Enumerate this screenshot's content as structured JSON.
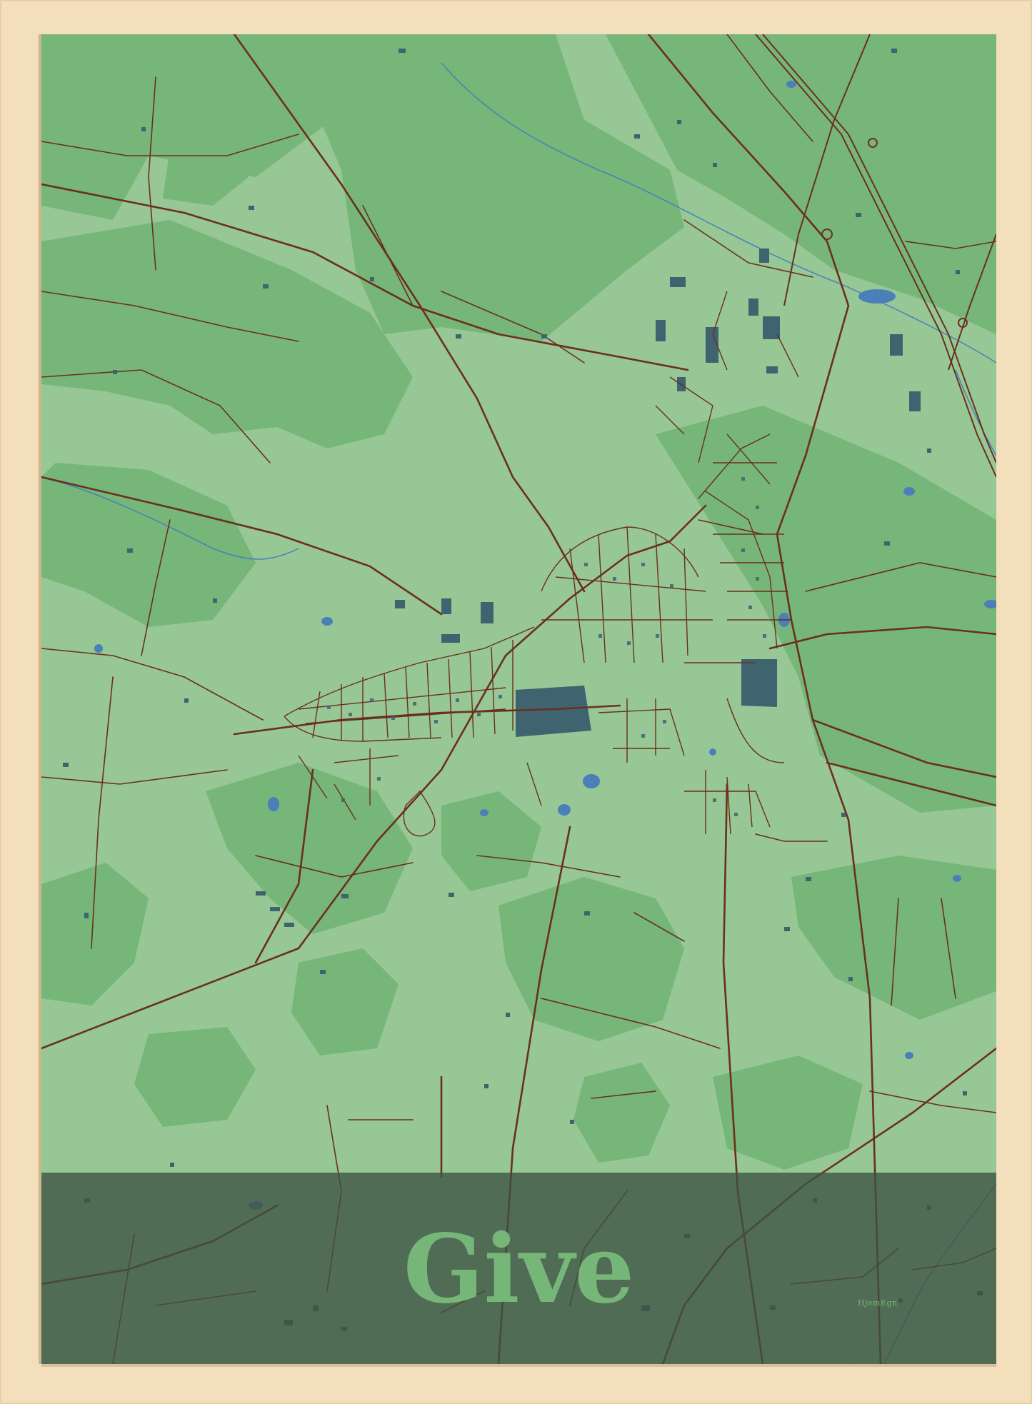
{
  "poster": {
    "title": "Give",
    "brand": "HjemEgn"
  },
  "colors": {
    "frame": "#f3dfbc",
    "field_light": "#96c794",
    "field_dark": "#76b679",
    "roads": "#6b2f1d",
    "buildings": "#3f6470",
    "water": "#4a7fb8",
    "title_band": "#3e5242",
    "title_text": "#76b679"
  }
}
